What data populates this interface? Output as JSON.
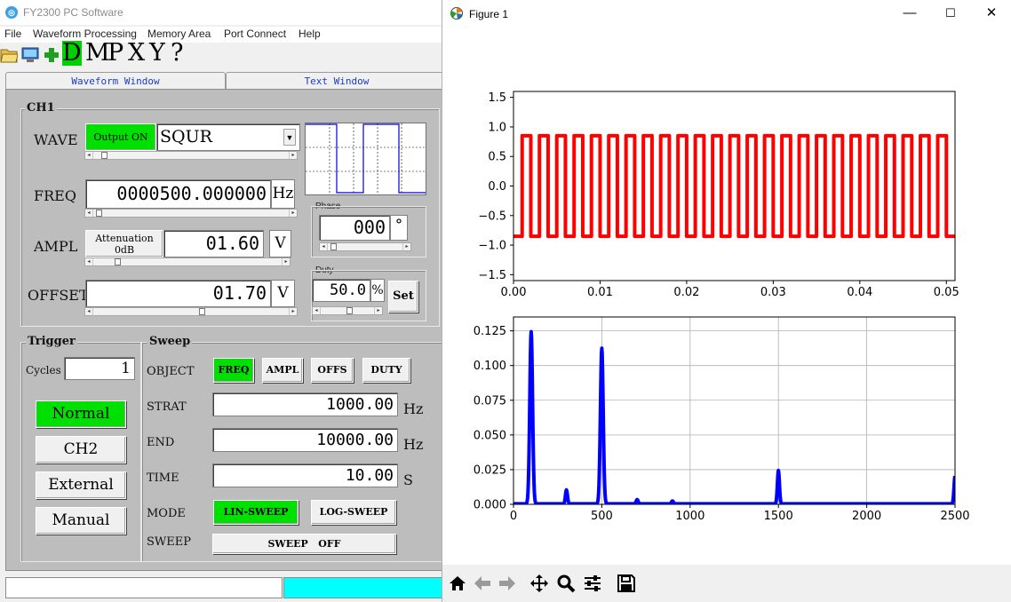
{
  "app": {
    "title": "FY2300 PC Software",
    "icon": "app-logo-icon",
    "menu": [
      "File",
      "Waveform Processing",
      "Memory Area",
      "Port Connect",
      "Help"
    ],
    "toolbar_icons": [
      "open-folder-icon",
      "monitor-icon",
      "add-icon"
    ],
    "toolbar_letters": [
      "D",
      "M",
      "P",
      "X",
      "Y",
      "?"
    ],
    "tabs": [
      "Waveform Window",
      "Text Window"
    ],
    "ch1": {
      "group_label": "CH1",
      "wave_label": "WAVE",
      "output_button": "Output ON",
      "wave_value": "SQUR",
      "freq_label": "FREQ",
      "freq_value": "0000500.000000",
      "freq_unit": "Hz",
      "ampl_label": "AMPL",
      "attenuation_button": "Attenuation\n0dB",
      "ampl_value": "01.60",
      "ampl_unit": "V",
      "offset_label": "OFFSET",
      "offset_value": "01.70",
      "offset_unit": "V",
      "phase_label": "Phase",
      "phase_value": "000",
      "phase_unit": "°",
      "duty_label": "Duty",
      "duty_value": "50.0",
      "duty_unit": "%",
      "set_button": "Set"
    },
    "trigger": {
      "group_label": "Trigger",
      "cycles_label": "Cycles",
      "cycles_value": "1",
      "buttons": [
        "Normal",
        "CH2",
        "External",
        "Manual"
      ],
      "active": "Normal"
    },
    "sweep": {
      "group_label": "Sweep",
      "object_label": "OBJECT",
      "objects": [
        "FREQ",
        "AMPL",
        "OFFS",
        "DUTY"
      ],
      "active_object": "FREQ",
      "strat_label": "STRAT",
      "strat_value": "1000.00",
      "strat_unit": "Hz",
      "end_label": "END",
      "end_value": "10000.00",
      "end_unit": "Hz",
      "time_label": "TIME",
      "time_value": "10.00",
      "time_unit": "S",
      "mode_label": "MODE",
      "modes": [
        "LIN-SWEEP",
        "LOG-SWEEP"
      ],
      "active_mode": "LIN-SWEEP",
      "sweep_label": "SWEEP",
      "sweep_button": "SWEEP   OFF"
    },
    "status_bar_color": "#00ffff"
  },
  "figure": {
    "title": "Figure 1",
    "icon": "matplotlib-icon",
    "window_controls": [
      "minimize-icon",
      "maximize-icon",
      "close-icon"
    ],
    "nav_icons": [
      "home-icon",
      "back-icon",
      "forward-icon",
      "pan-icon",
      "zoom-icon",
      "configure-icon",
      "save-icon"
    ]
  },
  "chart_data": [
    {
      "type": "line",
      "title": "",
      "xlabel": "",
      "ylabel": "",
      "xlim": [
        0,
        0.051
      ],
      "ylim": [
        -1.6,
        1.6
      ],
      "xticks": [
        "0.00",
        "0.01",
        "0.02",
        "0.03",
        "0.04",
        "0.05"
      ],
      "yticks": [
        "−1.5",
        "−1.0",
        "−0.5",
        "0.0",
        "0.5",
        "1.0",
        "1.5"
      ],
      "grid": false,
      "series": [
        {
          "color": "#ff0000",
          "kind": "square-wave",
          "frequency_hz": 500,
          "high": 0.85,
          "low": -0.85,
          "x_start": 0,
          "x_end": 0.051
        }
      ]
    },
    {
      "type": "line",
      "title": "",
      "xlabel": "",
      "ylabel": "",
      "xlim": [
        0,
        2500
      ],
      "ylim": [
        0,
        0.135
      ],
      "xticks": [
        "0",
        "500",
        "1000",
        "1500",
        "2000",
        "2500"
      ],
      "yticks": [
        "0.000",
        "0.025",
        "0.050",
        "0.075",
        "0.100",
        "0.125"
      ],
      "grid": true,
      "series": [
        {
          "color": "#0000ff",
          "peaks": [
            {
              "x": 100,
              "y": 0.124
            },
            {
              "x": 300,
              "y": 0.01
            },
            {
              "x": 500,
              "y": 0.112
            },
            {
              "x": 700,
              "y": 0.003
            },
            {
              "x": 900,
              "y": 0.002
            },
            {
              "x": 1500,
              "y": 0.024
            },
            {
              "x": 2500,
              "y": 0.02
            }
          ]
        }
      ]
    }
  ]
}
